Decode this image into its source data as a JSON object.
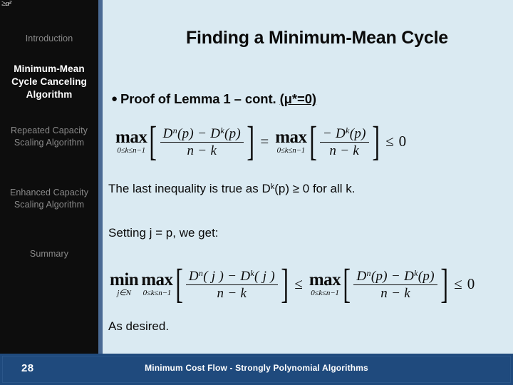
{
  "slide": {
    "title": "Finding a Minimum-Mean Cycle",
    "corner_fragment": "≥α²",
    "background_color": "#daeaf2",
    "sidebar_color": "#0d0d0d",
    "sidebar_edge_color": "#4a6a94",
    "footer_color": "#1f4a7d",
    "accent_color": "#1f4a7d"
  },
  "sidebar": {
    "items": [
      {
        "label": "Introduction",
        "active": false
      },
      {
        "label": "Minimum-Mean Cycle Canceling Algorithm",
        "active": true
      },
      {
        "label": "Repeated Capacity Scaling Algorithm",
        "active": false
      },
      {
        "label": "Enhanced Capacity Scaling Algorithm",
        "active": false
      },
      {
        "label": "Summary",
        "active": false
      }
    ]
  },
  "content": {
    "bullet": {
      "marker": "●",
      "text": "Proof of Lemma 1 – cont. ",
      "underlined": "(μ*=0)"
    },
    "text_1_prefix": "The last inequality is true as D",
    "text_1_sup": "k",
    "text_1_suffix": "(p) ≥ 0 for all k.",
    "text_2": "Setting j = p, we get:",
    "text_3": "As desired."
  },
  "formulas": [
    {
      "id": "formula-1",
      "latex": "\\max_{0 \\le k \\le n-1}\\left[\\frac{D^n(p) - D^k(p)}{n-k}\\right] = \\max_{0 \\le k \\le n-1}\\left[\\frac{-D^k(p)}{n-k}\\right] \\le 0",
      "parts": {
        "op1_name": "max",
        "op1_sub": "0≤k≤n−1",
        "frac1_num": "Dⁿ(p) − Dᵏ(p)",
        "frac1_num_base1": "D",
        "frac1_num_sup1": "n",
        "frac1_num_mid": "(p)  −  ",
        "frac1_num_base2": "D",
        "frac1_num_sup2": "k",
        "frac1_num_end": "(p)",
        "frac1_den": "n  −  k",
        "rel1": "=",
        "op2_name": "max",
        "op2_sub": "0≤k≤n−1",
        "frac2_num_lead": "−  ",
        "frac2_num_base": "D",
        "frac2_num_sup": "k",
        "frac2_num_end": "(p)",
        "frac2_den": "n  −  k",
        "rel2": "≤",
        "result": "0"
      }
    },
    {
      "id": "formula-2",
      "latex": "\\min_{j \\in N}\\max_{0 \\le k \\le n-1}\\left[\\frac{D^n(j) - D^k(j)}{n-k}\\right] \\le \\max_{0 \\le k \\le n-1}\\left[\\frac{D^n(p) - D^k(p)}{n-k}\\right] \\le 0",
      "parts": {
        "op0_name": "min",
        "op0_sub": "j∈N",
        "op1_name": "max",
        "op1_sub": "0≤k≤n−1",
        "frac1_num_base1": "D",
        "frac1_num_sup1": "n",
        "frac1_num_mid": "( j )  −  ",
        "frac1_num_base2": "D",
        "frac1_num_sup2": "k",
        "frac1_num_end": "( j )",
        "frac1_den": "n  −  k",
        "rel1": "≤",
        "op2_name": "max",
        "op2_sub": "0≤k≤n−1",
        "frac2_num_base1": "D",
        "frac2_num_sup1": "n",
        "frac2_num_mid": "(p)  −  ",
        "frac2_num_base2": "D",
        "frac2_num_sup2": "k",
        "frac2_num_end": "(p)",
        "frac2_den": "n  −  k",
        "rel2": "≤",
        "result": "0"
      }
    }
  ],
  "footer": {
    "page_number": "28",
    "title": "Minimum Cost Flow - Strongly Polynomial Algorithms"
  }
}
